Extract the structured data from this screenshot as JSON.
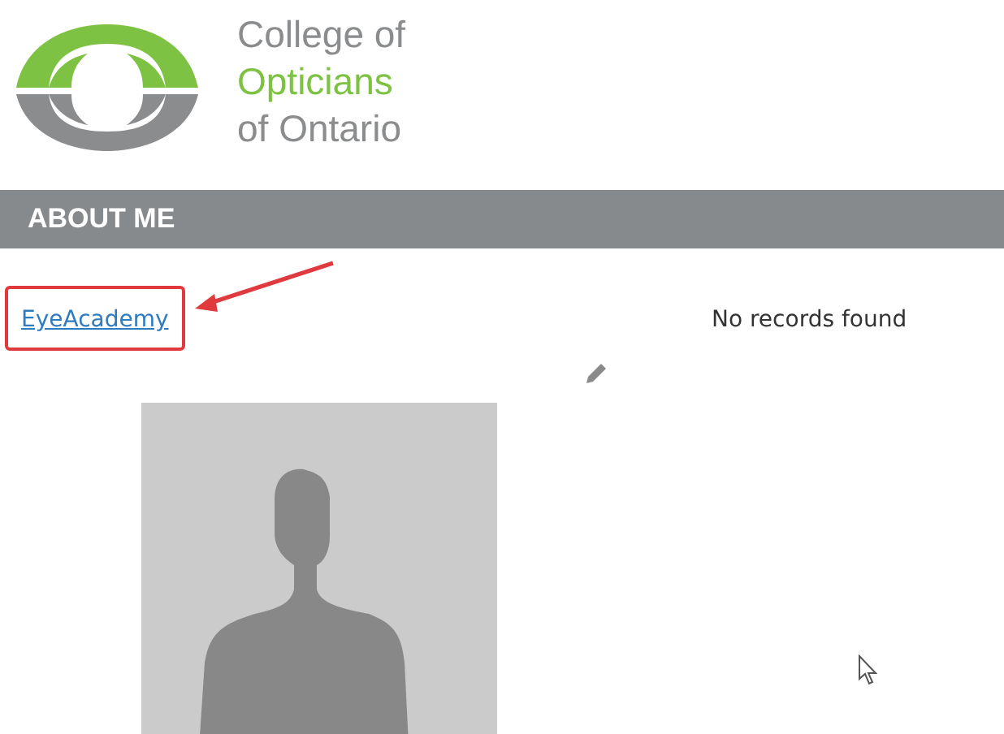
{
  "logo": {
    "lines": [
      {
        "text": "College of",
        "accent": false
      },
      {
        "text": "Opticians",
        "accent": true
      },
      {
        "text": "of Ontario",
        "accent": false
      }
    ]
  },
  "section": {
    "title": "ABOUT ME"
  },
  "link": {
    "label": "EyeAcademy",
    "highlighted": true
  },
  "message": "No records found"
}
